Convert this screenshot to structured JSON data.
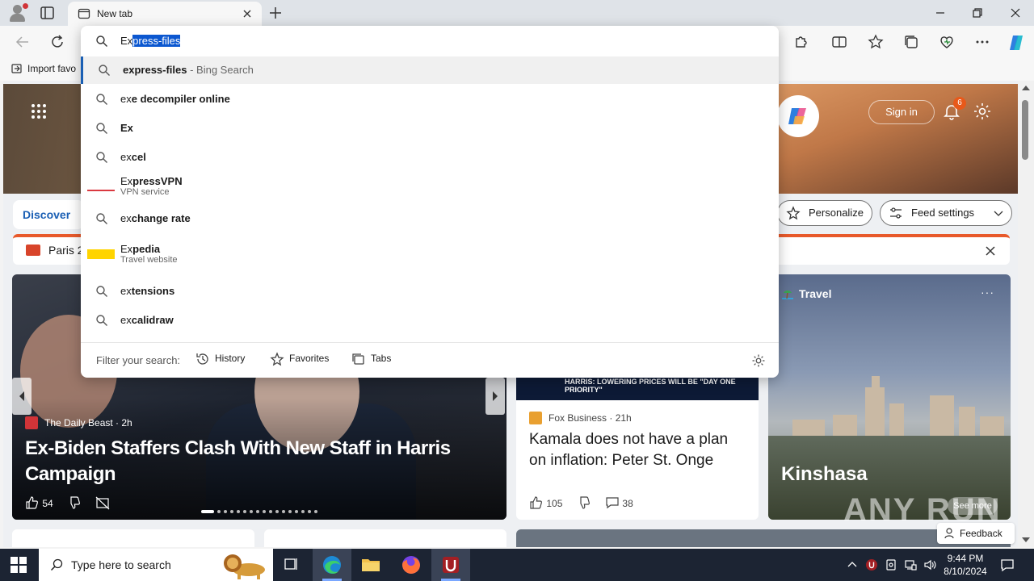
{
  "browser": {
    "tab": {
      "title": "New tab"
    },
    "favorites_bar": {
      "import_label": "Import favo"
    }
  },
  "omnibox": {
    "typed_prefix": "Ex",
    "typed_selected": "press-files",
    "suggestions": [
      {
        "bold_prefix": "",
        "text": "express-files",
        "sub": " - Bing Search",
        "icon": "search-icon"
      },
      {
        "bold_prefix": "ex",
        "text": "e decompiler online",
        "icon": "search-icon"
      },
      {
        "bold_prefix": "",
        "text": "Ex",
        "icon": "search-icon"
      },
      {
        "bold_prefix": "ex",
        "text": "cel",
        "icon": "search-icon"
      },
      {
        "bold_prefix": "Ex",
        "text": "pressVPN",
        "line2": "VPN service",
        "icon": "expressvpn-logo"
      },
      {
        "bold_prefix": "ex",
        "text": "change rate",
        "icon": "search-icon"
      },
      {
        "bold_prefix": "Ex",
        "text": "pedia",
        "line2": "Travel website",
        "icon": "expedia-logo"
      },
      {
        "bold_prefix": "ex",
        "text": "tensions",
        "icon": "search-icon"
      },
      {
        "bold_prefix": "ex",
        "text": "calidraw",
        "icon": "search-icon"
      }
    ],
    "filter": {
      "label": "Filter your search:",
      "history": "History",
      "favorites": "Favorites",
      "tabs": "Tabs"
    }
  },
  "newtab": {
    "sign_in": "Sign in",
    "notification_count": "6",
    "discover": "Discover",
    "personalize": "Personalize",
    "feed_settings": "Feed settings",
    "banner": "Paris 2",
    "main_story": {
      "source": "The Daily Beast",
      "age": "2h",
      "headline": "Ex-Biden Staffers Clash With New Staff in Harris Campaign",
      "likes": "54"
    },
    "fox_story": {
      "source": "Fox Business",
      "age": "21h",
      "headline": "Kamala does not have a plan on inflation: Peter St. Onge",
      "ticker": "HARRIS: LOWERING PRICES WILL BE \"DAY ONE PRIORITY\"",
      "likes": "105",
      "comments": "38"
    },
    "travel": {
      "label": "Travel",
      "place": "Kinshasa",
      "see_more": "See more"
    },
    "feedback": "Feedback",
    "watermark": "ANY RUN"
  },
  "taskbar": {
    "search_placeholder": "Type here to search",
    "time": "9:44 PM",
    "date": "8/10/2024"
  },
  "colors": {
    "accent": "#1a5fb4",
    "selection": "#0b57d0",
    "taskbar": "#1c2433",
    "notification_badge": "#e8591a"
  }
}
